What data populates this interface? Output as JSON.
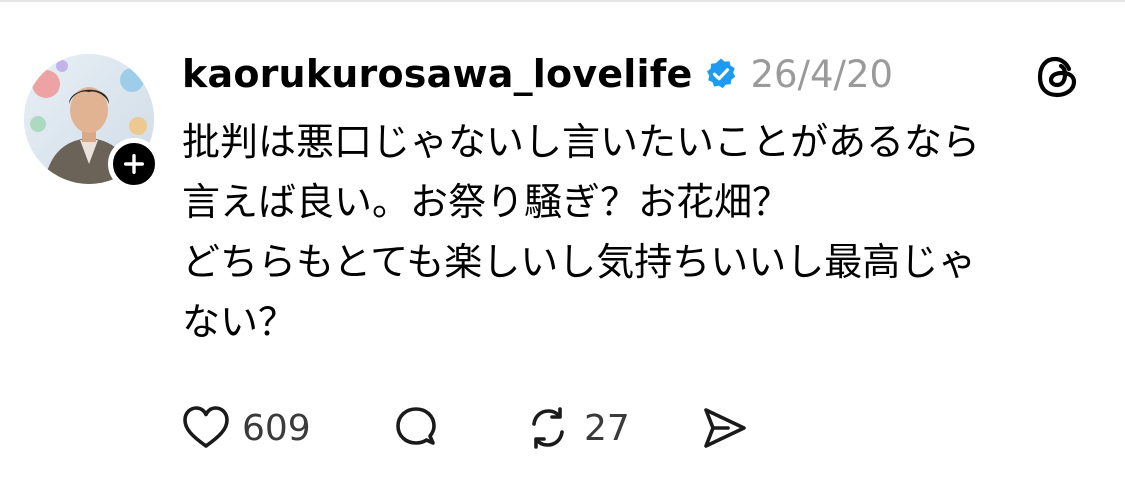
{
  "post": {
    "username": "kaorukurosawa_lovelife",
    "verified": true,
    "timestamp": "26/4/20",
    "avatar": {
      "name": "profile-photo"
    },
    "body_lines": [
      "批判は悪口じゃないし言いたいことがあるなら",
      "言えば良い。お祭り騒ぎ？お花畑？",
      "どちらもとても楽しいし気持ちいいし最高じゃ",
      "ない？"
    ],
    "actions": {
      "like_count": "609",
      "repost_count": "27"
    },
    "icons": {
      "verified": "verified-badge-icon",
      "threads": "threads-logo-icon",
      "like": "heart-icon",
      "comment": "comment-bubble-icon",
      "repost": "repost-icon",
      "share": "send-icon",
      "follow": "plus-icon"
    },
    "colors": {
      "verified_blue": "#1d9bf0",
      "timestamp_gray": "#9a9a9a",
      "text": "#000000",
      "icon": "#1a1a1a"
    }
  }
}
